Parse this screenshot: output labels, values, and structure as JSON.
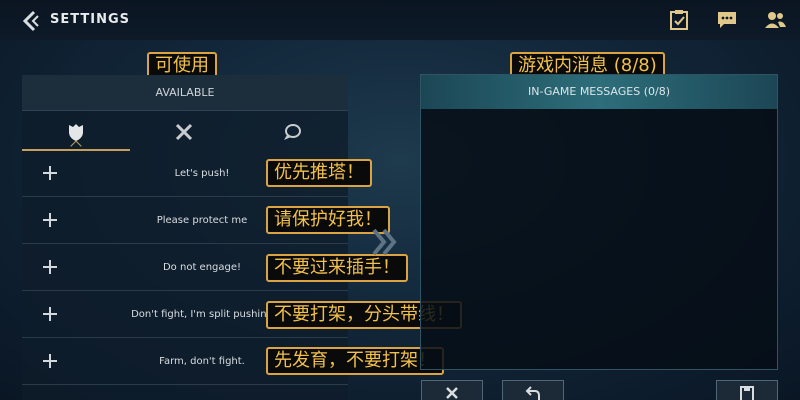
{
  "header": {
    "title": "SETTINGS",
    "icons": [
      "back-chevron-icon",
      "checklist-icon",
      "chat-icon",
      "friends-icon"
    ]
  },
  "annotations": {
    "available": "可使用",
    "messages": "游戏内消息 (8/8)",
    "items": [
      "优先推塔！",
      "请保护好我！",
      "不要过来插手！",
      "不要打架，分头带线！",
      "先发育，不要打架！"
    ]
  },
  "available_panel": {
    "header": "AVAILABLE",
    "tabs": [
      "shield-icon",
      "crossed-swords-icon",
      "chat-bubble-icon"
    ],
    "selected_tab": 0,
    "items": [
      "Let's push!",
      "Please protect me",
      "Do not engage!",
      "Don't fight, I'm split pushing",
      "Farm, don't fight."
    ]
  },
  "messages_panel": {
    "header": "IN-GAME MESSAGES (0/8)"
  },
  "bottom_buttons": [
    "close-icon",
    "undo-icon",
    "save-icon"
  ],
  "colors": {
    "accent_gold": "#d9a441",
    "annotation_text": "#f2c04c",
    "teal_header": "#2d6e7a"
  }
}
